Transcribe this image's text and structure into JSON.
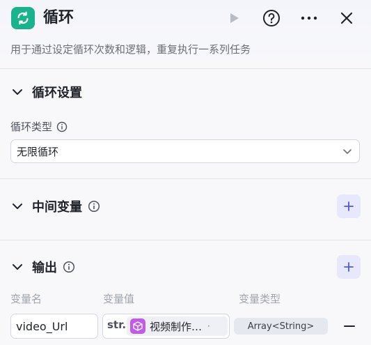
{
  "header": {
    "title": "循环",
    "subtitle": "用于通过设定循环次数和逻辑，重复执行一系列任务",
    "icons": [
      "loop-icon",
      "play-icon",
      "help-icon",
      "more-icon",
      "close-icon"
    ]
  },
  "loop_settings": {
    "title": "循环设置",
    "loop_type_label": "循环类型",
    "loop_type_value": "无限循环"
  },
  "intermediate_vars": {
    "title": "中间变量"
  },
  "output": {
    "title": "输出",
    "columns": {
      "name": "变量名",
      "value": "变量值",
      "type": "变量类型"
    },
    "row": {
      "name": "video_Url",
      "type_prefix": "str.",
      "ref_label": "视频制作…",
      "ref_dot": "·",
      "var_type": "Array<String>"
    }
  },
  "colors": {
    "brand_green": "#19b38e",
    "node_purple": "#c05ce8",
    "add_button_bg": "#e7e8fc",
    "add_button_plus": "#4f5bd5"
  }
}
